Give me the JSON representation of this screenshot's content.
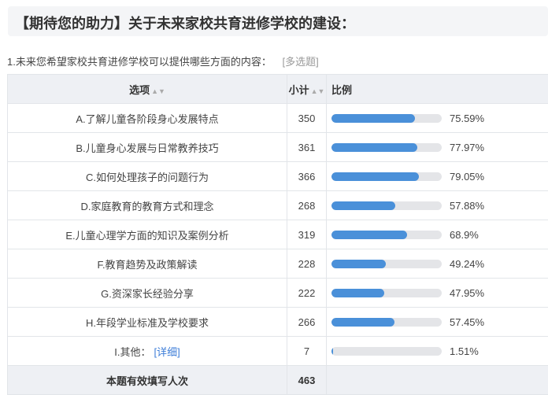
{
  "header": {
    "title": "【期待您的助力】关于未来家校共育进修学校的建设："
  },
  "question": {
    "text": "1.未来您希望家校共育进修学校可以提供哪些方面的内容：",
    "tag": "[多选题]"
  },
  "table": {
    "col_option": "选项",
    "col_count": "小计",
    "col_ratio": "比例",
    "rows": [
      {
        "option": "A.了解儿童各阶段身心发展特点",
        "count": "350",
        "pct": "75.59%",
        "ratio": 0.7559
      },
      {
        "option": "B.儿童身心发展与日常教养技巧",
        "count": "361",
        "pct": "77.97%",
        "ratio": 0.7797
      },
      {
        "option": "C.如何处理孩子的问题行为",
        "count": "366",
        "pct": "79.05%",
        "ratio": 0.7905
      },
      {
        "option": "D.家庭教育的教育方式和理念",
        "count": "268",
        "pct": "57.88%",
        "ratio": 0.5788
      },
      {
        "option": "E.儿童心理学方面的知识及案例分析",
        "count": "319",
        "pct": "68.9%",
        "ratio": 0.689
      },
      {
        "option": "F.教育趋势及政策解读",
        "count": "228",
        "pct": "49.24%",
        "ratio": 0.4924
      },
      {
        "option": "G.资深家长经验分享",
        "count": "222",
        "pct": "47.95%",
        "ratio": 0.4795
      },
      {
        "option": "H.年段学业标准及学校要求",
        "count": "266",
        "pct": "57.45%",
        "ratio": 0.5745
      }
    ],
    "other": {
      "option": "I.其他：",
      "detail": "[详细]",
      "count": "7",
      "pct": "1.51%",
      "ratio": 0.0151
    },
    "footer": {
      "label": "本题有效填写人次",
      "count": "463"
    }
  },
  "colors": {
    "bar": "#4a90d9",
    "track": "#e4e5e8",
    "link": "#3d7dd8"
  }
}
